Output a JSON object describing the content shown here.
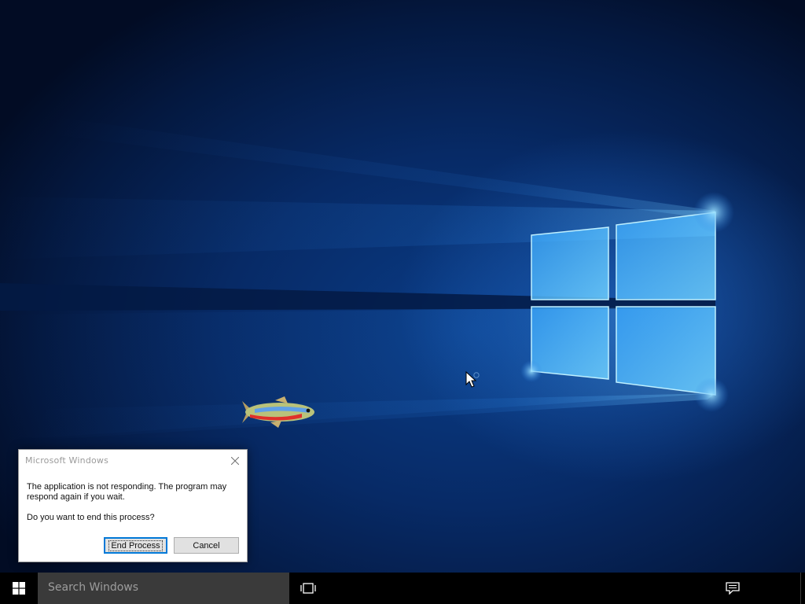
{
  "dialog": {
    "title": "Microsoft Windows",
    "message": "The application is not responding. The program may respond again if you wait.",
    "question": "Do you want to end this process?",
    "end_process_label": "End Process",
    "cancel_label": "Cancel",
    "close_icon": "close-icon"
  },
  "taskbar": {
    "search_placeholder": "Search Windows",
    "start_icon": "windows-logo-icon",
    "task_view_icon": "task-view-icon",
    "action_center_icon": "action-center-icon"
  },
  "desktop": {
    "wallpaper": "windows-10-hero-wallpaper",
    "sprite": "neon-tetra-fish",
    "cursor": "arrow-cursor-icon"
  },
  "colors": {
    "accent": "#0078d7",
    "taskbar": "#000000",
    "search_box": "#3a3a3a",
    "wallpaper_dark": "#04183f",
    "wallpaper_light": "#7fd3ff"
  }
}
